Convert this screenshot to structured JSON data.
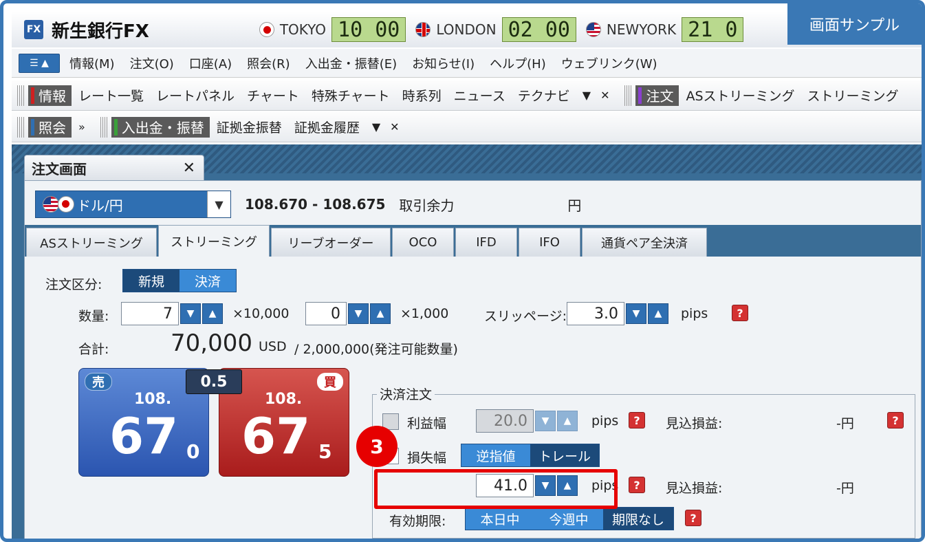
{
  "badge": "画面サンプル",
  "app": {
    "logo": "FX",
    "title": "新生銀行FX"
  },
  "clocks": [
    {
      "city": "TOKYO",
      "time": "10 00",
      "flag": "flag-jp-icon"
    },
    {
      "city": "LONDON",
      "time": "02 00",
      "flag": "flag-uk-icon"
    },
    {
      "city": "NEWYORK",
      "time": "21 0",
      "flag": "flag-us-icon"
    }
  ],
  "menu": [
    "情報(M)",
    "注文(O)",
    "口座(A)",
    "照会(R)",
    "入出金・振替(E)",
    "お知らせ(I)",
    "ヘルプ(H)",
    "ウェブリンク(W)"
  ],
  "toolbar1": {
    "group1": "情報",
    "items1": [
      "レート一覧",
      "レートパネル",
      "チャート",
      "特殊チャート",
      "時系列",
      "ニュース",
      "テクナビ"
    ],
    "group2": "注文",
    "items2": [
      "ASストリーミング",
      "ストリーミング"
    ]
  },
  "toolbar2": {
    "group1": "照会",
    "group2": "入出金・振替",
    "items2": [
      "証拠金振替",
      "証拠金履歴"
    ]
  },
  "window": {
    "title": "注文画面"
  },
  "pair": {
    "name": "ドル/円",
    "rate": "108.670 - 108.675",
    "margin_label": "取引余力",
    "currency": "円"
  },
  "tabs": [
    "ASストリーミング",
    "ストリーミング",
    "リーブオーダー",
    "OCO",
    "IFD",
    "IFO",
    "通貨ペア全決済"
  ],
  "form": {
    "order_type_label": "注文区分:",
    "order_type_new": "新規",
    "order_type_settle": "決済",
    "qty_label": "数量:",
    "qty_value": "7",
    "qty_unit": "×10,000",
    "qty2_value": "0",
    "qty2_unit": "×1,000",
    "slippage_label": "スリッページ:",
    "slippage_value": "3.0",
    "pips": "pips",
    "total_label": "合計:",
    "total_value": "70,000",
    "total_unit": "USD",
    "total_max": "/ 2,000,000(発注可能数量)"
  },
  "sell": {
    "tag": "売",
    "head": "108.",
    "big": "67",
    "small": "0"
  },
  "buy": {
    "tag": "買",
    "head": "108.",
    "big": "67",
    "small": "5"
  },
  "spread": "0.5",
  "settle": {
    "legend": "決済注文",
    "profit_label": "利益幅",
    "profit_value": "20.0",
    "loss_label": "損失幅",
    "loss_mode_stop": "逆指値",
    "loss_mode_trail": "トレール",
    "loss_value": "41.0",
    "expected_label": "見込損益:",
    "expected_value": "-円",
    "expiry_label": "有効期限:",
    "expiry_today": "本日中",
    "expiry_week": "今週中",
    "expiry_none": "期限なし"
  },
  "step": "3",
  "help": "?"
}
